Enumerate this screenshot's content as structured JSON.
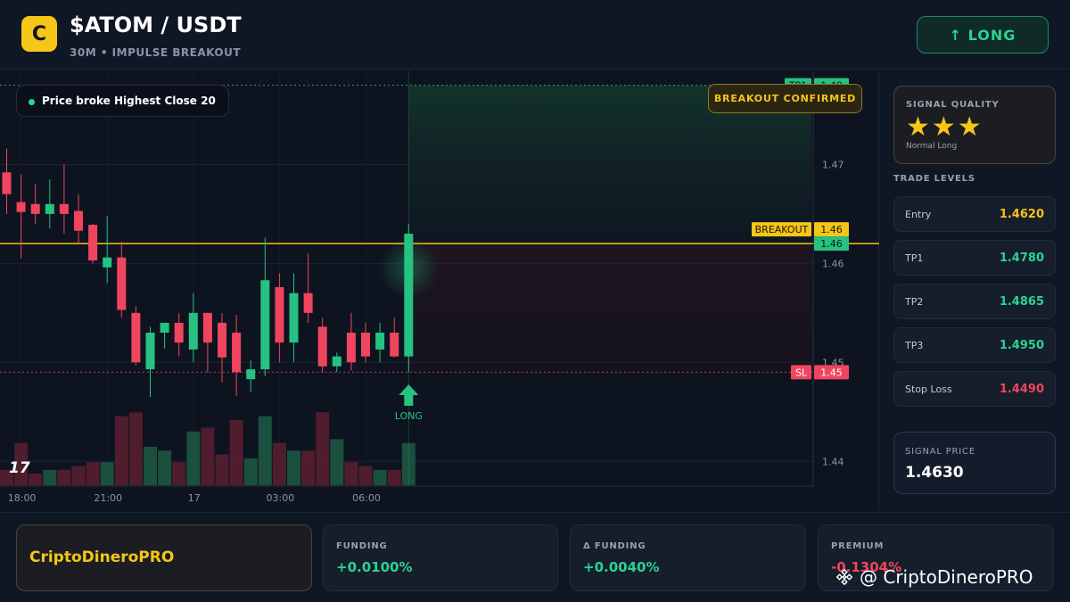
{
  "header": {
    "logo_letter": "C",
    "pair": "$ATOM / USDT",
    "subtitle": "30M • IMPULSE BREAKOUT",
    "long_button": "↑ LONG"
  },
  "chart": {
    "info_pill": "Price broke Highest Close 20",
    "breakout_badge": "BREAKOUT CONFIRMED",
    "tv_logo": "17",
    "long_marker_label": "LONG",
    "price_ticks": [
      {
        "label": "1.47",
        "price": 1.47
      },
      {
        "label": "1.46",
        "price": 1.46
      },
      {
        "label": "1.45",
        "price": 1.45
      },
      {
        "label": "1.44",
        "price": 1.44
      }
    ],
    "time_ticks": [
      {
        "label": "18:00",
        "index": 1
      },
      {
        "label": "21:00",
        "index": 7
      },
      {
        "label": "17",
        "index": 13
      },
      {
        "label": "03:00",
        "index": 19
      },
      {
        "label": "06:00",
        "index": 25
      }
    ],
    "lines": {
      "tp1": {
        "tag": "TP1",
        "value": "1.48",
        "price": 1.478
      },
      "breakout": {
        "tag": "BREAKOUT",
        "value": "1.46",
        "price": 1.462
      },
      "current": {
        "value": "1.46",
        "price": 1.462
      },
      "sl": {
        "tag": "SL",
        "value": "1.45",
        "price": 1.449
      }
    },
    "colors": {
      "up": "#26c281",
      "down": "#f0455e",
      "breakout": "#f5c518",
      "tp": "#26c281",
      "sl": "#f0455e"
    }
  },
  "chart_data": {
    "type": "candlestick",
    "price_range": [
      1.4375,
      1.4795
    ],
    "candles": [
      {
        "o": 1.4692,
        "h": 1.4716,
        "l": 1.465,
        "c": 1.467
      },
      {
        "o": 1.4662,
        "h": 1.469,
        "l": 1.4605,
        "c": 1.4652
      },
      {
        "o": 1.466,
        "h": 1.468,
        "l": 1.464,
        "c": 1.465
      },
      {
        "o": 1.465,
        "h": 1.4685,
        "l": 1.4635,
        "c": 1.466
      },
      {
        "o": 1.466,
        "h": 1.47,
        "l": 1.463,
        "c": 1.465
      },
      {
        "o": 1.4653,
        "h": 1.467,
        "l": 1.462,
        "c": 1.4633
      },
      {
        "o": 1.4639,
        "h": 1.464,
        "l": 1.46,
        "c": 1.4603
      },
      {
        "o": 1.4596,
        "h": 1.4648,
        "l": 1.458,
        "c": 1.4606
      },
      {
        "o": 1.4606,
        "h": 1.4622,
        "l": 1.4545,
        "c": 1.4553
      },
      {
        "o": 1.455,
        "h": 1.4557,
        "l": 1.4497,
        "c": 1.45
      },
      {
        "o": 1.4493,
        "h": 1.4536,
        "l": 1.4465,
        "c": 1.453
      },
      {
        "o": 1.453,
        "h": 1.454,
        "l": 1.4514,
        "c": 1.454
      },
      {
        "o": 1.454,
        "h": 1.455,
        "l": 1.4506,
        "c": 1.452
      },
      {
        "o": 1.4513,
        "h": 1.457,
        "l": 1.45,
        "c": 1.455
      },
      {
        "o": 1.455,
        "h": 1.455,
        "l": 1.449,
        "c": 1.452
      },
      {
        "o": 1.454,
        "h": 1.455,
        "l": 1.448,
        "c": 1.4505
      },
      {
        "o": 1.453,
        "h": 1.4548,
        "l": 1.4466,
        "c": 1.449
      },
      {
        "o": 1.4483,
        "h": 1.4502,
        "l": 1.447,
        "c": 1.4493
      },
      {
        "o": 1.4493,
        "h": 1.4626,
        "l": 1.4486,
        "c": 1.4583
      },
      {
        "o": 1.4576,
        "h": 1.459,
        "l": 1.45,
        "c": 1.452
      },
      {
        "o": 1.452,
        "h": 1.459,
        "l": 1.45,
        "c": 1.457
      },
      {
        "o": 1.457,
        "h": 1.461,
        "l": 1.454,
        "c": 1.455
      },
      {
        "o": 1.4536,
        "h": 1.4545,
        "l": 1.449,
        "c": 1.4496
      },
      {
        "o": 1.4496,
        "h": 1.451,
        "l": 1.449,
        "c": 1.4506
      },
      {
        "o": 1.453,
        "h": 1.455,
        "l": 1.4492,
        "c": 1.45
      },
      {
        "o": 1.453,
        "h": 1.454,
        "l": 1.45,
        "c": 1.4506
      },
      {
        "o": 1.4513,
        "h": 1.454,
        "l": 1.45,
        "c": 1.453
      },
      {
        "o": 1.453,
        "h": 1.4545,
        "l": 1.4505,
        "c": 1.4506
      },
      {
        "o": 1.4506,
        "h": 1.464,
        "l": 1.449,
        "c": 1.463
      }
    ],
    "volumes": [
      0.2,
      0.55,
      0.15,
      0.2,
      0.2,
      0.25,
      0.3,
      0.3,
      0.9,
      0.95,
      0.5,
      0.45,
      0.3,
      0.7,
      0.75,
      0.4,
      0.85,
      0.35,
      0.9,
      0.55,
      0.45,
      0.45,
      0.95,
      0.6,
      0.3,
      0.25,
      0.2,
      0.2,
      0.55
    ]
  },
  "panel": {
    "quality_title": "SIGNAL QUALITY",
    "stars": "★★★",
    "quality_desc": "Normal Long",
    "levels_title": "TRADE LEVELS",
    "levels": [
      {
        "label": "Entry",
        "value": "1.4620",
        "color": "#f5c518"
      },
      {
        "label": "TP1",
        "value": "1.4780",
        "color": "#2ad394"
      },
      {
        "label": "TP2",
        "value": "1.4865",
        "color": "#2ad394"
      },
      {
        "label": "TP3",
        "value": "1.4950",
        "color": "#2ad394"
      },
      {
        "label": "Stop Loss",
        "value": "1.4490",
        "color": "#f0455e"
      }
    ],
    "signal_price_title": "SIGNAL PRICE",
    "signal_price": "1.4630"
  },
  "bottom": {
    "brand": "CriptoDineroPRO",
    "stats": [
      {
        "title": "FUNDING",
        "value": "+0.0100%",
        "color": "#2ad394"
      },
      {
        "title": "Δ FUNDING",
        "value": "+0.0040%",
        "color": "#2ad394"
      },
      {
        "title": "PREMIUM",
        "value": "-0.1304%",
        "color": "#f0455e"
      }
    ],
    "watermark": "@ CriptoDineroPRO"
  }
}
